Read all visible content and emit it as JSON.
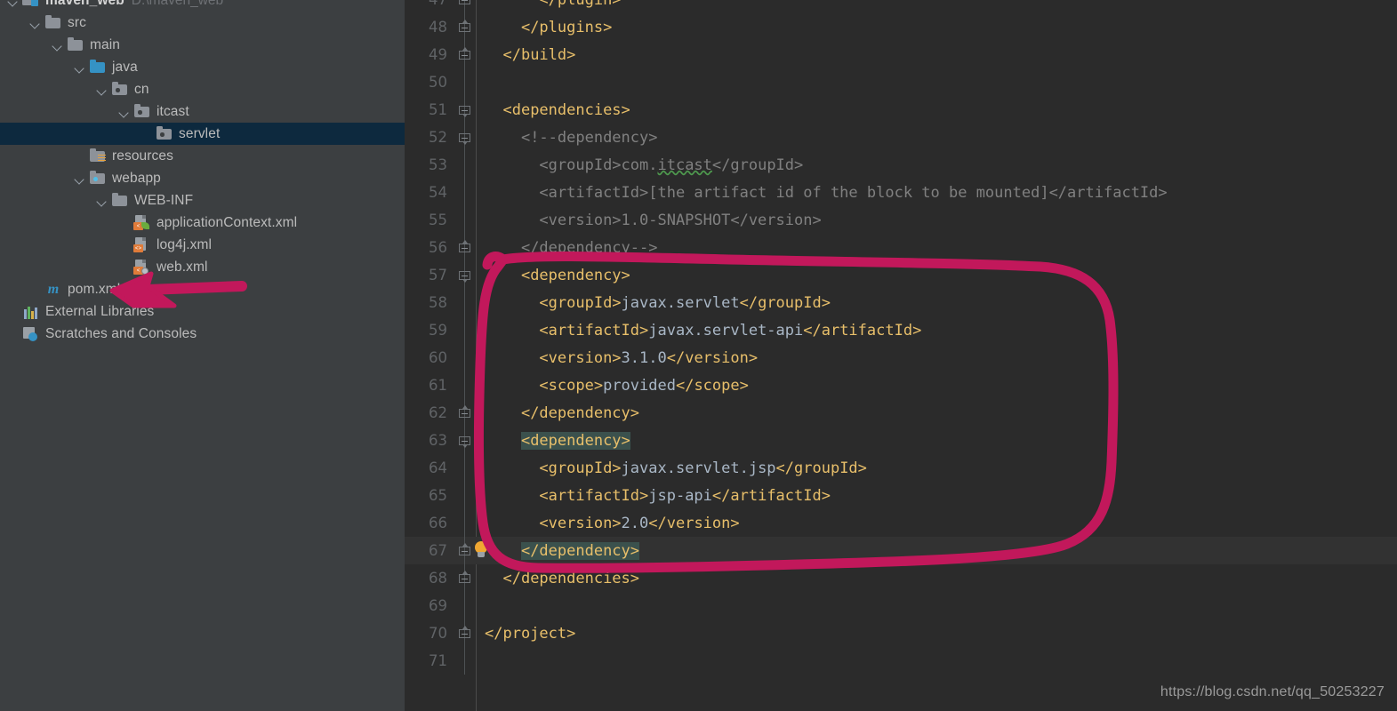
{
  "window": {
    "theme": "darcula",
    "accent_pink": "#c2185b",
    "editor_bg": "#2b2b2b",
    "sidebar_bg": "#3c3f41",
    "tag_color": "#e8bf6a",
    "text_color": "#a9b7c6",
    "comment_color": "#808080",
    "selection_bg": "#0d293e",
    "bracket_match_bg": "#3b514d"
  },
  "sidebar": {
    "name": "project-tree",
    "items": [
      {
        "label": "maven_web",
        "sublabel": "D:\\maven_web",
        "icon": "project-root-icon",
        "depth": 0,
        "chevron": "open",
        "selected": false,
        "bold": true
      },
      {
        "label": "src",
        "sublabel": "",
        "icon": "folder-icon",
        "depth": 1,
        "chevron": "open",
        "selected": false,
        "bold": false
      },
      {
        "label": "main",
        "sublabel": "",
        "icon": "folder-icon",
        "depth": 2,
        "chevron": "open",
        "selected": false,
        "bold": false
      },
      {
        "label": "java",
        "sublabel": "",
        "icon": "source-root-folder-icon",
        "depth": 3,
        "chevron": "open",
        "selected": false,
        "bold": false
      },
      {
        "label": "cn",
        "sublabel": "",
        "icon": "package-folder-icon",
        "depth": 4,
        "chevron": "open",
        "selected": false,
        "bold": false
      },
      {
        "label": "itcast",
        "sublabel": "",
        "icon": "package-folder-icon",
        "depth": 5,
        "chevron": "open",
        "selected": false,
        "bold": false
      },
      {
        "label": "servlet",
        "sublabel": "",
        "icon": "package-folder-icon",
        "depth": 6,
        "chevron": "none",
        "selected": true,
        "bold": false
      },
      {
        "label": "resources",
        "sublabel": "",
        "icon": "resources-folder-icon",
        "depth": 3,
        "chevron": "none",
        "selected": false,
        "bold": false
      },
      {
        "label": "webapp",
        "sublabel": "",
        "icon": "webapp-folder-icon",
        "depth": 3,
        "chevron": "open",
        "selected": false,
        "bold": false
      },
      {
        "label": "WEB-INF",
        "sublabel": "",
        "icon": "folder-icon",
        "depth": 4,
        "chevron": "open",
        "selected": false,
        "bold": false
      },
      {
        "label": "applicationContext.xml",
        "sublabel": "",
        "icon": "spring-xml-file-icon",
        "depth": 5,
        "chevron": "none",
        "selected": false,
        "bold": false
      },
      {
        "label": "log4j.xml",
        "sublabel": "",
        "icon": "xml-file-icon",
        "depth": 5,
        "chevron": "none",
        "selected": false,
        "bold": false
      },
      {
        "label": "web.xml",
        "sublabel": "",
        "icon": "web-xml-file-icon",
        "depth": 5,
        "chevron": "none",
        "selected": false,
        "bold": false
      },
      {
        "label": "pom.xml",
        "sublabel": "",
        "icon": "maven-pom-icon",
        "depth": 1,
        "chevron": "none",
        "selected": false,
        "bold": false
      },
      {
        "label": "External Libraries",
        "sublabel": "",
        "icon": "external-libraries-icon",
        "depth": 0,
        "chevron": "none",
        "selected": false,
        "bold": false
      },
      {
        "label": "Scratches and Consoles",
        "sublabel": "",
        "icon": "scratches-consoles-icon",
        "depth": 0,
        "chevron": "none",
        "selected": false,
        "bold": false
      }
    ]
  },
  "editor": {
    "name": "pom-xml-editor",
    "language": "xml",
    "first_visible_line": 47,
    "last_visible_line": 71,
    "current_line": 67,
    "lines": [
      {
        "n": 47,
        "fold": "mid",
        "bulb": false,
        "current": false,
        "spans": [
          {
            "t": "      ",
            "c": "txt"
          },
          {
            "t": "</plugin>",
            "c": "tag"
          }
        ]
      },
      {
        "n": 48,
        "fold": "bot",
        "bulb": false,
        "current": false,
        "spans": [
          {
            "t": "    ",
            "c": "txt"
          },
          {
            "t": "</plugins>",
            "c": "tag"
          }
        ]
      },
      {
        "n": 49,
        "fold": "bot",
        "bulb": false,
        "current": false,
        "spans": [
          {
            "t": "  ",
            "c": "txt"
          },
          {
            "t": "</build>",
            "c": "tag"
          }
        ]
      },
      {
        "n": 50,
        "fold": "none",
        "bulb": false,
        "current": false,
        "spans": []
      },
      {
        "n": 51,
        "fold": "top",
        "bulb": false,
        "current": false,
        "spans": [
          {
            "t": "  ",
            "c": "txt"
          },
          {
            "t": "<dependencies>",
            "c": "tag"
          }
        ]
      },
      {
        "n": 52,
        "fold": "top",
        "bulb": false,
        "current": false,
        "spans": [
          {
            "t": "    ",
            "c": "txt"
          },
          {
            "t": "<!--dependency>",
            "c": "cmt"
          }
        ]
      },
      {
        "n": 53,
        "fold": "none",
        "bulb": false,
        "current": false,
        "spans": [
          {
            "t": "      ",
            "c": "txt"
          },
          {
            "t": "<groupId>com.",
            "c": "cmt"
          },
          {
            "t": "itcast",
            "c": "cmt typo"
          },
          {
            "t": "</groupId>",
            "c": "cmt"
          }
        ]
      },
      {
        "n": 54,
        "fold": "none",
        "bulb": false,
        "current": false,
        "spans": [
          {
            "t": "      ",
            "c": "txt"
          },
          {
            "t": "<artifactId>[the artifact id of the block to be mounted]</artifactId>",
            "c": "cmt"
          }
        ]
      },
      {
        "n": 55,
        "fold": "none",
        "bulb": false,
        "current": false,
        "spans": [
          {
            "t": "      ",
            "c": "txt"
          },
          {
            "t": "<version>1.0-SNAPSHOT</version>",
            "c": "cmt"
          }
        ]
      },
      {
        "n": 56,
        "fold": "bot",
        "bulb": false,
        "current": false,
        "spans": [
          {
            "t": "    ",
            "c": "txt"
          },
          {
            "t": "</dependency-->",
            "c": "cmt"
          }
        ]
      },
      {
        "n": 57,
        "fold": "top",
        "bulb": false,
        "current": false,
        "spans": [
          {
            "t": "    ",
            "c": "txt"
          },
          {
            "t": "<dependency>",
            "c": "tag"
          }
        ]
      },
      {
        "n": 58,
        "fold": "none",
        "bulb": false,
        "current": false,
        "spans": [
          {
            "t": "      ",
            "c": "txt"
          },
          {
            "t": "<groupId>",
            "c": "tag"
          },
          {
            "t": "javax.servlet",
            "c": "txt"
          },
          {
            "t": "</groupId>",
            "c": "tag"
          }
        ]
      },
      {
        "n": 59,
        "fold": "none",
        "bulb": false,
        "current": false,
        "spans": [
          {
            "t": "      ",
            "c": "txt"
          },
          {
            "t": "<artifactId>",
            "c": "tag"
          },
          {
            "t": "javax.servlet-api",
            "c": "txt"
          },
          {
            "t": "</artifactId>",
            "c": "tag"
          }
        ]
      },
      {
        "n": 60,
        "fold": "none",
        "bulb": false,
        "current": false,
        "spans": [
          {
            "t": "      ",
            "c": "txt"
          },
          {
            "t": "<version>",
            "c": "tag"
          },
          {
            "t": "3.1.0",
            "c": "txt"
          },
          {
            "t": "</version>",
            "c": "tag"
          }
        ]
      },
      {
        "n": 61,
        "fold": "none",
        "bulb": false,
        "current": false,
        "spans": [
          {
            "t": "      ",
            "c": "txt"
          },
          {
            "t": "<scope>",
            "c": "tag"
          },
          {
            "t": "provided",
            "c": "txt"
          },
          {
            "t": "</scope>",
            "c": "tag"
          }
        ]
      },
      {
        "n": 62,
        "fold": "bot",
        "bulb": false,
        "current": false,
        "spans": [
          {
            "t": "    ",
            "c": "txt"
          },
          {
            "t": "</dependency>",
            "c": "tag"
          }
        ]
      },
      {
        "n": 63,
        "fold": "top",
        "bulb": false,
        "current": false,
        "spans": [
          {
            "t": "    ",
            "c": "txt"
          },
          {
            "t": "<dependency>",
            "c": "tag hl"
          }
        ]
      },
      {
        "n": 64,
        "fold": "none",
        "bulb": false,
        "current": false,
        "spans": [
          {
            "t": "      ",
            "c": "txt"
          },
          {
            "t": "<groupId>",
            "c": "tag"
          },
          {
            "t": "javax.servlet.jsp",
            "c": "txt"
          },
          {
            "t": "</groupId>",
            "c": "tag"
          }
        ]
      },
      {
        "n": 65,
        "fold": "none",
        "bulb": false,
        "current": false,
        "spans": [
          {
            "t": "      ",
            "c": "txt"
          },
          {
            "t": "<artifactId>",
            "c": "tag"
          },
          {
            "t": "jsp-api",
            "c": "txt"
          },
          {
            "t": "</artifactId>",
            "c": "tag"
          }
        ]
      },
      {
        "n": 66,
        "fold": "none",
        "bulb": false,
        "current": false,
        "spans": [
          {
            "t": "      ",
            "c": "txt"
          },
          {
            "t": "<version>",
            "c": "tag"
          },
          {
            "t": "2.0",
            "c": "txt"
          },
          {
            "t": "</version>",
            "c": "tag"
          }
        ]
      },
      {
        "n": 67,
        "fold": "bot",
        "bulb": true,
        "current": true,
        "spans": [
          {
            "t": "    ",
            "c": "txt"
          },
          {
            "t": "</dependency>",
            "c": "tag hl"
          }
        ]
      },
      {
        "n": 68,
        "fold": "bot",
        "bulb": false,
        "current": false,
        "spans": [
          {
            "t": "  ",
            "c": "txt"
          },
          {
            "t": "</dependencies>",
            "c": "tag"
          }
        ]
      },
      {
        "n": 69,
        "fold": "none",
        "bulb": false,
        "current": false,
        "spans": []
      },
      {
        "n": 70,
        "fold": "bot",
        "bulb": false,
        "current": false,
        "spans": [
          {
            "t": "</project>",
            "c": "tag"
          }
        ]
      },
      {
        "n": 71,
        "fold": "none",
        "bulb": false,
        "current": false,
        "spans": []
      }
    ]
  },
  "annotations": {
    "name": "ink-annotations",
    "color": "#c2185b",
    "arrow": {
      "label": "arrow-pointing-to-pom-xml",
      "target": "pom.xml"
    },
    "circle": {
      "label": "circled-jsp-api-dependency-block",
      "covers_lines": [
        57,
        67
      ]
    }
  },
  "watermark": {
    "text": "https://blog.csdn.net/qq_50253227"
  }
}
